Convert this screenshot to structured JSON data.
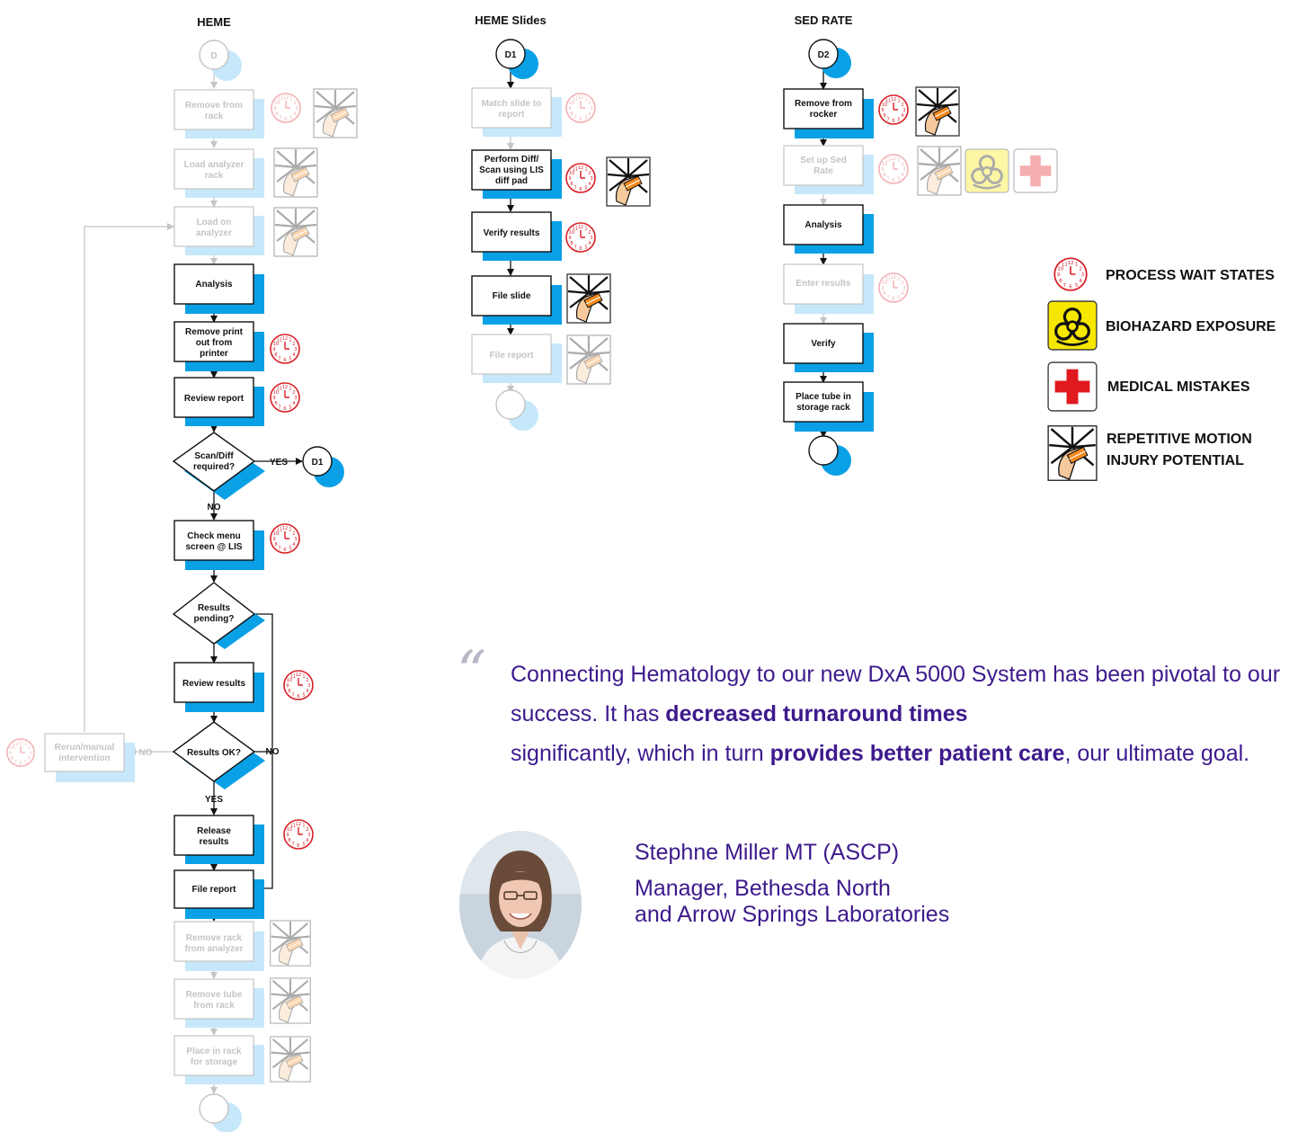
{
  "columns": {
    "heme": "HEME",
    "heme_slides": "HEME Slides",
    "sed_rate": "SED RATE"
  },
  "heme": {
    "start": "D",
    "remove_from_rack": [
      "Remove from",
      "rack"
    ],
    "load_analyzer_rack": [
      "Load analyzer",
      "rack"
    ],
    "load_on_analyzer": [
      "Load on",
      "analyzer"
    ],
    "analysis": "Analysis",
    "remove_print": [
      "Remove print",
      "out from",
      "printer"
    ],
    "review_report": "Review report",
    "scan_diff": [
      "Scan/Diff",
      "required?"
    ],
    "yes": "YES",
    "d1_ref": "D1",
    "no": "NO",
    "check_menu": [
      "Check menu",
      "screen @ LIS"
    ],
    "results_pending": [
      "Results",
      "pending?"
    ],
    "review_results": "Review results",
    "results_ok": "Results OK?",
    "rerun": [
      "Rerun/manual",
      "intervention"
    ],
    "release": [
      "Release",
      "results"
    ],
    "file_report": "File report",
    "remove_rack": [
      "Remove rack",
      "from analyzer"
    ],
    "remove_tube": [
      "Remove tube",
      "from rack"
    ],
    "place_rack": [
      "Place in rack",
      "for storage"
    ]
  },
  "slides": {
    "start": "D1",
    "match_slide": [
      "Match slide to",
      "report"
    ],
    "perform_diff": [
      "Perform Diff/",
      "Scan using LIS",
      "diff pad"
    ],
    "verify_results": "Verify results",
    "file_slide": "File slide",
    "file_report": "File report"
  },
  "sed": {
    "start": "D2",
    "remove_rocker": [
      "Remove from",
      "rocker"
    ],
    "setup_sed": [
      "Set up Sed",
      "Rate"
    ],
    "analysis": "Analysis",
    "enter_results": "Enter results",
    "verify": "Verify",
    "place_tube": [
      "Place tube in",
      "storage rack"
    ]
  },
  "legend": {
    "wait": "PROCESS WAIT STATES",
    "biohazard": "BIOHAZARD EXPOSURE",
    "mistakes": "MEDICAL MISTAKES",
    "rmi": [
      "REPETITIVE MOTION",
      "INJURY POTENTIAL"
    ]
  },
  "quote": {
    "p1": "Connecting Hematology to our new DxA 5000 System has been pivotal to our success. It has ",
    "b1": "decreased turnaround times",
    "p2": " significantly, which in turn ",
    "b2": "provides better patient care",
    "p3": ", our ultimate goal."
  },
  "attribution": {
    "name": "Stephne Miller MT (ASCP)",
    "title1": "Manager, Bethesda North",
    "title2": "and Arrow Springs Laboratories"
  },
  "colors": {
    "shadow": "#0aa0e6",
    "wait_red": "#d81f26",
    "biohazard_yellow": "#f7e600",
    "cross_red": "#e0191f",
    "quote_purple": "#3d1a8c"
  }
}
